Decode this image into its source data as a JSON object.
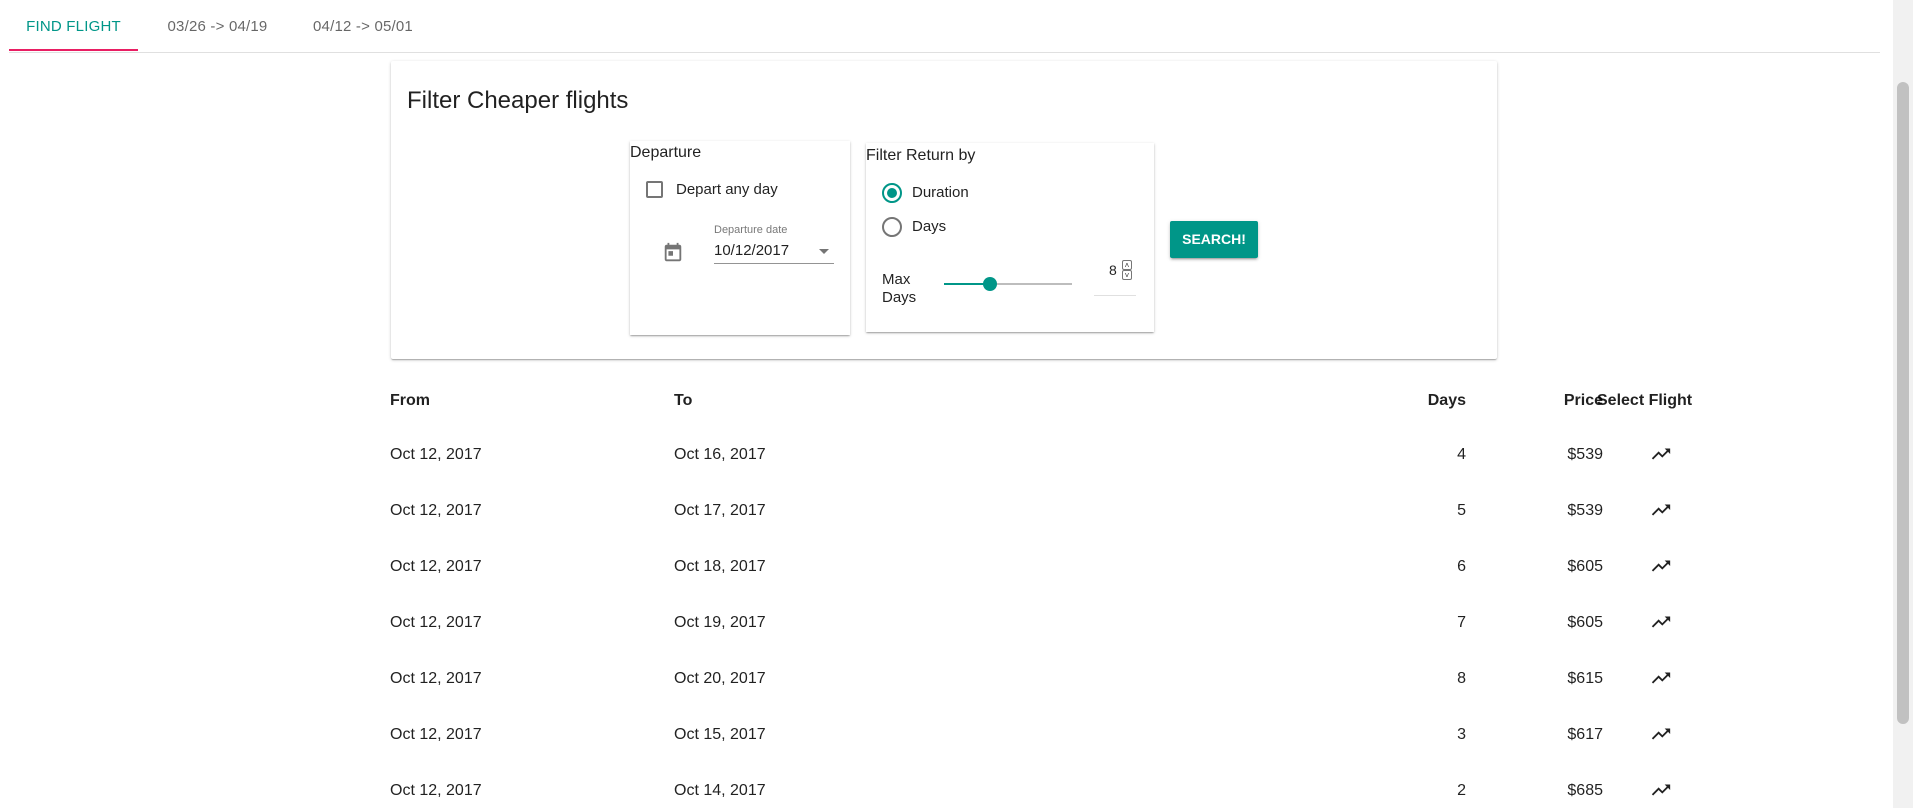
{
  "tabs": [
    {
      "label": "FIND FLIGHT",
      "active": true
    },
    {
      "label": "03/26 -> 04/19",
      "active": false
    },
    {
      "label": "04/12 -> 05/01",
      "active": false
    }
  ],
  "colors": {
    "accent": "#009688",
    "tab_indicator": "#e91e63"
  },
  "filter": {
    "title": "Filter Cheaper flights",
    "departure": {
      "legend": "Departure",
      "any_day_label": "Depart any day",
      "any_day_checked": false,
      "date_label": "Departure date",
      "date_value": "10/12/2017",
      "calendar_icon": "calendar-icon"
    },
    "return_filter": {
      "legend": "Filter Return by",
      "options": [
        {
          "label": "Duration",
          "selected": true
        },
        {
          "label": "Days",
          "selected": false
        }
      ],
      "max_days_label_1": "Max",
      "max_days_label_2": "Days",
      "max_days_value": "8"
    },
    "search_label": "SEARCH!"
  },
  "table": {
    "headers": {
      "from": "From",
      "to": "To",
      "days": "Days",
      "price": "Price",
      "select": "Select Flight"
    },
    "rows": [
      {
        "from": "Oct 12, 2017",
        "to": "Oct 16, 2017",
        "days": "4",
        "price": "$539"
      },
      {
        "from": "Oct 12, 2017",
        "to": "Oct 17, 2017",
        "days": "5",
        "price": "$539"
      },
      {
        "from": "Oct 12, 2017",
        "to": "Oct 18, 2017",
        "days": "6",
        "price": "$605"
      },
      {
        "from": "Oct 12, 2017",
        "to": "Oct 19, 2017",
        "days": "7",
        "price": "$605"
      },
      {
        "from": "Oct 12, 2017",
        "to": "Oct 20, 2017",
        "days": "8",
        "price": "$615"
      },
      {
        "from": "Oct 12, 2017",
        "to": "Oct 15, 2017",
        "days": "3",
        "price": "$617"
      },
      {
        "from": "Oct 12, 2017",
        "to": "Oct 14, 2017",
        "days": "2",
        "price": "$685"
      }
    ],
    "select_icon": "trending-up-icon"
  }
}
